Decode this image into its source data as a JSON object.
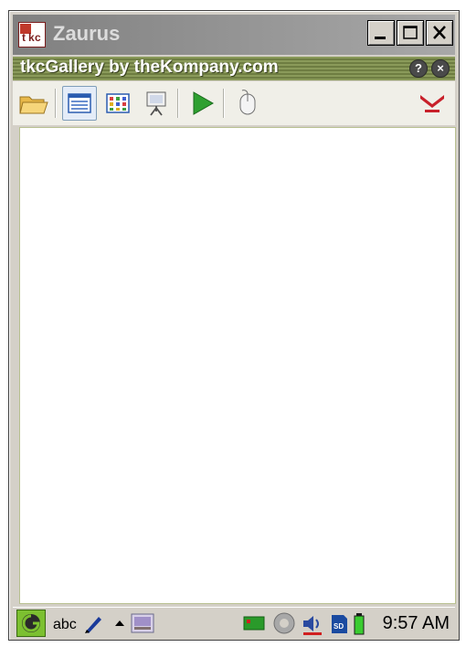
{
  "window": {
    "title": "Zaurus",
    "app_icon": "tkc-logo-icon",
    "controls": [
      "minimize-icon",
      "maximize-icon",
      "close-icon"
    ]
  },
  "app": {
    "title": "tkcGallery by theKompany.com",
    "help_label": "?",
    "close_label": "×"
  },
  "toolbar": {
    "items": [
      "open-folder-icon",
      "detail-view-icon",
      "thumbnail-view-icon",
      "slideshow-icon",
      "play-icon",
      "mouse-icon",
      "thekompany-logo-icon"
    ]
  },
  "taskbar": {
    "input_method": "abc",
    "clock": "9:57 AM",
    "icons": [
      "start-menu-icon",
      "pen-icon",
      "arrow-up-icon",
      "image-icon",
      "network-icon",
      "settings-gear-icon",
      "volume-icon",
      "sd-card-icon",
      "battery-icon"
    ]
  },
  "colors": {
    "titlebar": "#a8a8a8",
    "app_title_bar": "#7d8c4e",
    "content_bg": "#ffffff",
    "taskbar": "#d4d0c8"
  }
}
